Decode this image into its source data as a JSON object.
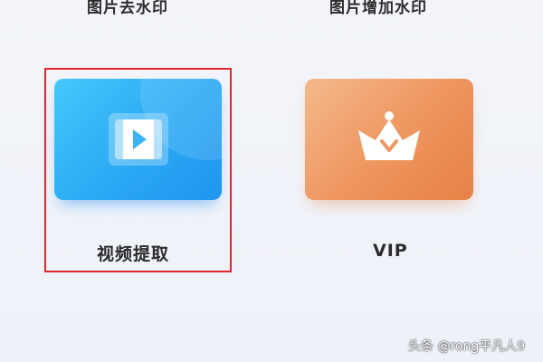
{
  "top_labels": {
    "left": "图片去水印",
    "right": "图片增加水印"
  },
  "tiles": [
    {
      "label": "视频提取",
      "icon": "video-play-icon",
      "highlighted": true,
      "color": "#2aa9f4"
    },
    {
      "label": "VIP",
      "icon": "crown-icon",
      "highlighted": false,
      "color": "#ef9761"
    }
  ],
  "highlight_color": "#e0282f",
  "watermark": "头条 @rong平凡人9"
}
